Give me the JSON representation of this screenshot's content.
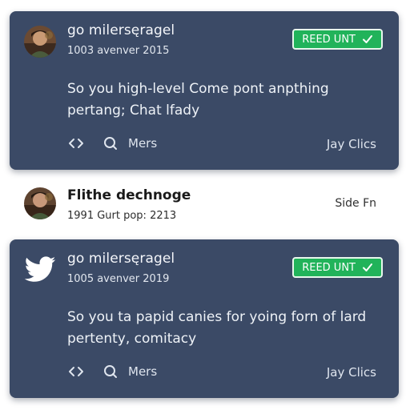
{
  "posts": [
    {
      "author": "go milersęragel",
      "meta": "1003 avenver 2015",
      "badge_label": "REED UNT",
      "badge_icon": "check-icon",
      "body_line1": "So you high-level Come pont anpthing",
      "body_line2": "pertang; Chat lfady",
      "actions": {
        "share_icon": "share-arrows-icon",
        "search_icon": "search-icon",
        "mers_label": "Mers"
      },
      "right_link": "Jay Clics"
    },
    {
      "author": "go milersęragel",
      "meta": "1005 avenver 2019",
      "badge_label": "REED UNT",
      "badge_icon": "check-icon",
      "body_line1": "So you ta papid canies for yoing forn of lard",
      "body_line2": "pertenty, comitacy",
      "actions": {
        "share_icon": "share-arrows-icon",
        "search_icon": "search-icon",
        "mers_label": "Mers"
      },
      "right_link": "Jay Clics"
    }
  ],
  "row": {
    "title": "Flithe dechnoge",
    "meta": "1991 Gurt pop: 2213",
    "link": "Side Fn"
  },
  "colors": {
    "card_bg": "#3b4a66",
    "badge_green": "#21b35a",
    "twitter_icon": "#ffffff"
  }
}
